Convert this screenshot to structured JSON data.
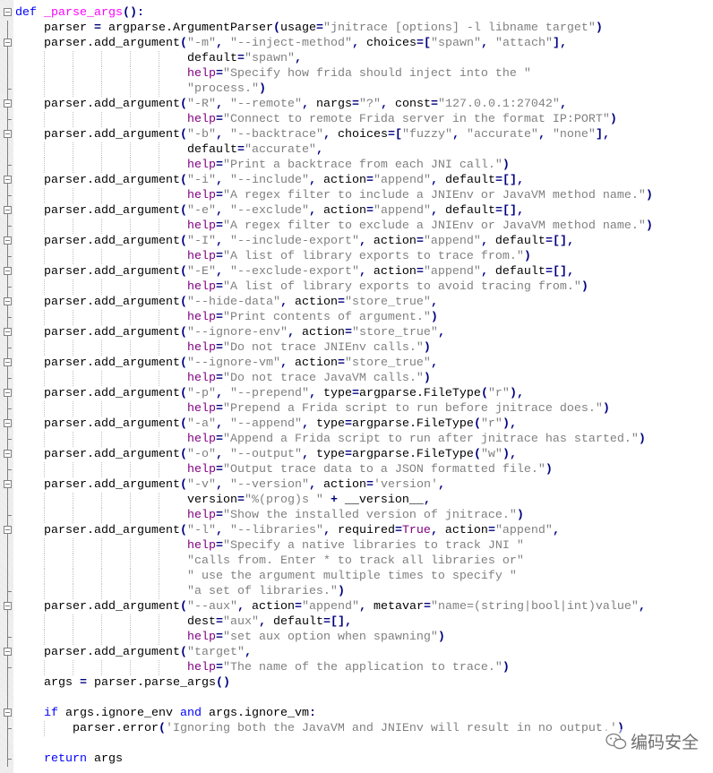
{
  "editor": {
    "lines": [
      "def _parse_args():",
      "    parser = argparse.ArgumentParser(usage=\"jnitrace [options] -l libname target\")",
      "    parser.add_argument(\"-m\", \"--inject-method\", choices=[\"spawn\", \"attach\"],",
      "                        default=\"spawn\",",
      "                        help=\"Specify how frida should inject into the \"",
      "                        \"process.\")",
      "    parser.add_argument(\"-R\", \"--remote\", nargs=\"?\", const=\"127.0.0.1:27042\",",
      "                        help=\"Connect to remote Frida server in the format IP:PORT\")",
      "    parser.add_argument(\"-b\", \"--backtrace\", choices=[\"fuzzy\", \"accurate\", \"none\"],",
      "                        default=\"accurate\",",
      "                        help=\"Print a backtrace from each JNI call.\")",
      "    parser.add_argument(\"-i\", \"--include\", action=\"append\", default=[],",
      "                        help=\"A regex filter to include a JNIEnv or JavaVM method name.\")",
      "    parser.add_argument(\"-e\", \"--exclude\", action=\"append\", default=[],",
      "                        help=\"A regex filter to exclude a JNIEnv or JavaVM method name.\")",
      "    parser.add_argument(\"-I\", \"--include-export\", action=\"append\", default=[],",
      "                        help=\"A list of library exports to trace from.\")",
      "    parser.add_argument(\"-E\", \"--exclude-export\", action=\"append\", default=[],",
      "                        help=\"A list of library exports to avoid tracing from.\")",
      "    parser.add_argument(\"--hide-data\", action=\"store_true\",",
      "                        help=\"Print contents of argument.\")",
      "    parser.add_argument(\"--ignore-env\", action=\"store_true\",",
      "                        help=\"Do not trace JNIEnv calls.\")",
      "    parser.add_argument(\"--ignore-vm\", action=\"store_true\",",
      "                        help=\"Do not trace JavaVM calls.\")",
      "    parser.add_argument(\"-p\", \"--prepend\", type=argparse.FileType(\"r\"),",
      "                        help=\"Prepend a Frida script to run before jnitrace does.\")",
      "    parser.add_argument(\"-a\", \"--append\", type=argparse.FileType(\"r\"),",
      "                        help=\"Append a Frida script to run after jnitrace has started.\")",
      "    parser.add_argument(\"-o\", \"--output\", type=argparse.FileType(\"w\"),",
      "                        help=\"Output trace data to a JSON formatted file.\")",
      "    parser.add_argument(\"-v\", \"--version\", action='version',",
      "                        version=\"%(prog)s \" + __version__,",
      "                        help=\"Show the installed version of jnitrace.\")",
      "    parser.add_argument(\"-l\", \"--libraries\", required=True, action=\"append\",",
      "                        help=\"Specify a native libraries to track JNI \"",
      "                        \"calls from. Enter * to track all libraries or\"",
      "                        \" use the argument multiple times to specify \"",
      "                        \"a set of libraries.\")",
      "    parser.add_argument(\"--aux\", action=\"append\", metavar=\"name=(string|bool|int)value\",",
      "                        dest=\"aux\", default=[],",
      "                        help=\"set aux option when spawning\")",
      "    parser.add_argument(\"target\",",
      "                        help=\"The name of the application to trace.\")",
      "    args = parser.parse_args()",
      "",
      "    if args.ignore_env and args.ignore_vm:",
      "        parser.error('Ignoring both the JavaVM and JNIEnv will result in no output.')",
      "",
      "    return args"
    ]
  },
  "watermark": {
    "icon": "wechat-icon",
    "text": "编码安全"
  },
  "colors": {
    "keyword": "#0000ff",
    "function": "#ff00ff",
    "string": "#808080",
    "builtin": "#800080",
    "operator": "#000080"
  }
}
